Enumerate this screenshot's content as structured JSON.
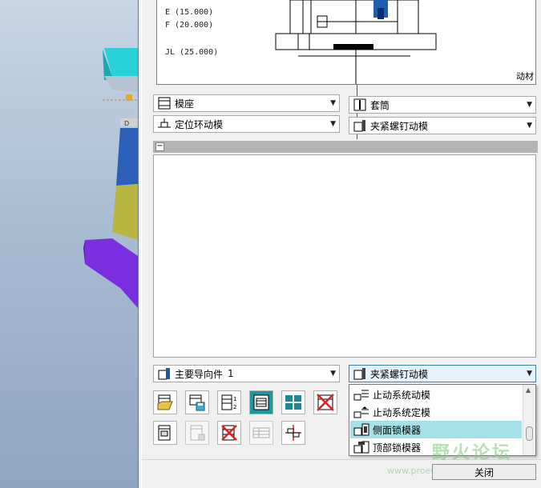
{
  "preview": {
    "legend": [
      "E (15.000)",
      "F (20.000)",
      "JL (25.000)"
    ],
    "corner_label": "动材"
  },
  "dropdowns": {
    "top_left": "模座",
    "top_right": "套筒",
    "second_left": "定位环动模",
    "second_right": "夹紧螺钉动模",
    "bottom_left": "主要导向件",
    "bottom_left_extra": "1",
    "bottom_right": "夹紧螺钉动模"
  },
  "list": {
    "collapse_glyph": "−"
  },
  "toolbar": {
    "row1": [
      "open-assembly-icon",
      "save-assembly-icon",
      "numbered-list-icon",
      "frame-icon",
      "grid-icon",
      "delete-frame-icon"
    ],
    "row2": [
      "component-icon",
      "copy-component-icon",
      "remove-component-icon",
      "table-icon",
      "dimension-icon"
    ]
  },
  "popup": {
    "items": [
      "止动系统动模",
      "止动系统定模",
      "侧面锁模器",
      "顶部锁模器"
    ],
    "selected_index": 2
  },
  "close_label": "关闭",
  "watermark": {
    "text": "野火论坛",
    "sub": "www.proewildfire.cn"
  },
  "colors": {
    "selection": "#a6e1ea",
    "cyan_part": "#22d0d8",
    "blue_part": "#2c5fb8",
    "olive_part": "#b8b640",
    "purple_part": "#7a2ee0"
  }
}
